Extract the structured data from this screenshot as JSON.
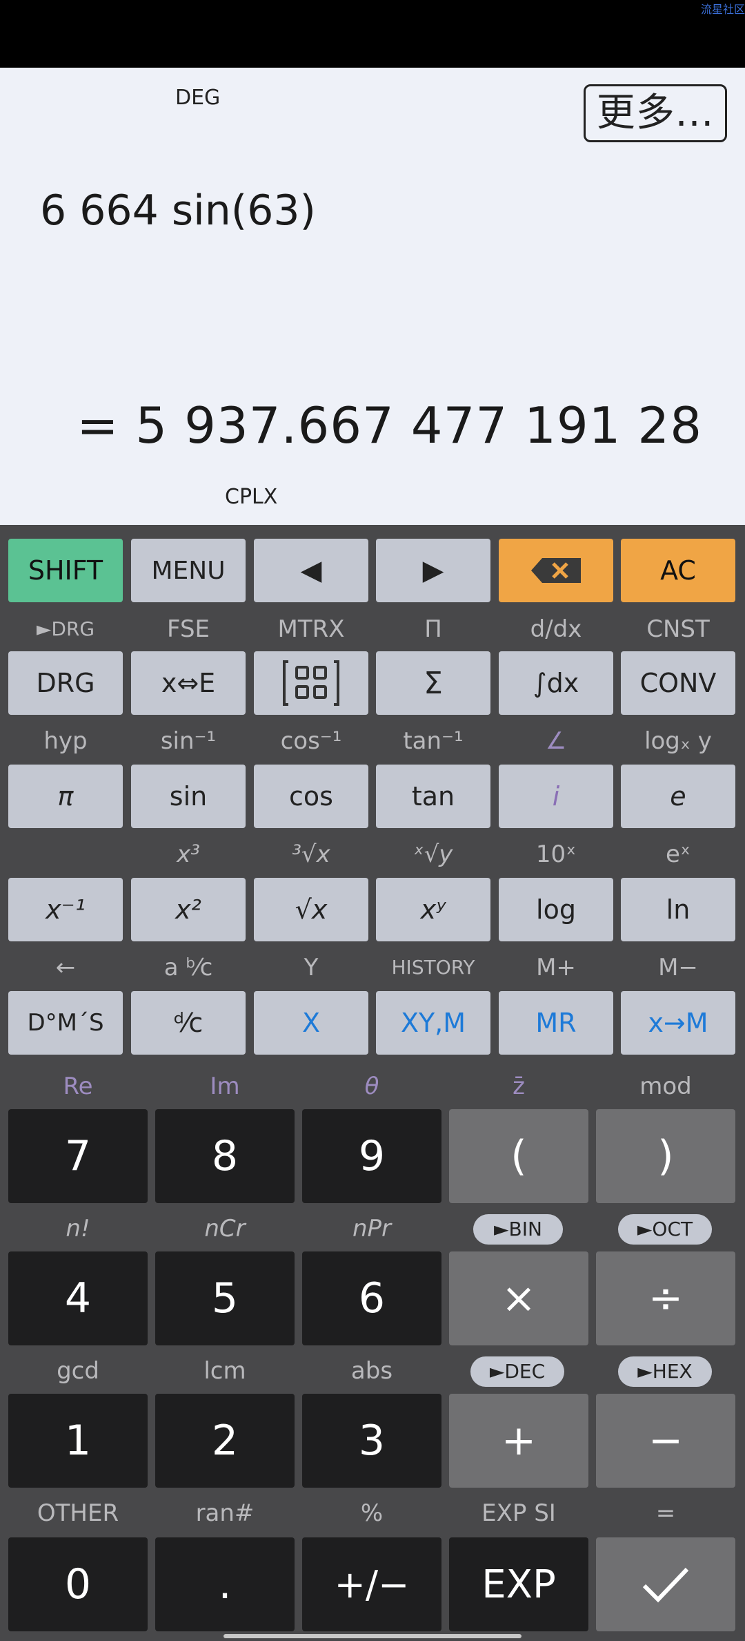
{
  "watermark": "流星社区",
  "display": {
    "angle_mode": "DEG",
    "more_button": "更多...",
    "expression": "6 664 sin(63)",
    "result": "= 5 937.667 477 191 28",
    "mode": "CPLX"
  },
  "keys": {
    "shift": "SHIFT",
    "menu": "MENU",
    "left": "◀",
    "right": "▶",
    "backspace": "⌫",
    "ac": "AC",
    "drg": "DRG",
    "xe": "x⇔E",
    "matrix": "[⠿]",
    "sigma": "Σ",
    "integral": "∫dx",
    "conv": "CONV",
    "pi": "π",
    "sin": "sin",
    "cos": "cos",
    "tan": "tan",
    "i": "i",
    "e": "e",
    "xinv": "x⁻¹",
    "xsq": "x²",
    "sqrt": "√x",
    "xpow": "xʸ",
    "log": "log",
    "ln": "ln",
    "dms": "D°M´S",
    "dc": "ᵈ⁄c",
    "x": "X",
    "xym": "XY,M",
    "mr": "MR",
    "xtom": "x→M",
    "n7": "7",
    "n8": "8",
    "n9": "9",
    "lparen": "(",
    "rparen": ")",
    "n4": "4",
    "n5": "5",
    "n6": "6",
    "mul": "×",
    "div": "÷",
    "n1": "1",
    "n2": "2",
    "n3": "3",
    "plus": "+",
    "minus": "−",
    "n0": "0",
    "dot": ".",
    "neg": "+/−",
    "exp": "EXP",
    "equals": "✓"
  },
  "labels": {
    "r1": [
      "►DRG",
      "FSE",
      "MTRX",
      "Π",
      "d/dx",
      "CNST"
    ],
    "r2": [
      "hyp",
      "sin⁻¹",
      "cos⁻¹",
      "tan⁻¹",
      "∠",
      "logₓ y"
    ],
    "r3": [
      "x³",
      "³√x",
      "ˣ√y",
      "10ˣ",
      "eˣ"
    ],
    "r4": [
      "←",
      "a ᵇ⁄c",
      "Y",
      "HISTORY",
      "M+",
      "M−"
    ],
    "r5": [
      "Re",
      "Im",
      "θ",
      "z̄",
      "mod"
    ],
    "r6": [
      "n!",
      "nCr",
      "nPr"
    ],
    "r6pills": [
      "►BIN",
      "►OCT"
    ],
    "r7": [
      "gcd",
      "lcm",
      "abs"
    ],
    "r7pills": [
      "►DEC",
      "►HEX"
    ],
    "r8": [
      "OTHER",
      "ran#",
      "%",
      "EXP SI",
      "="
    ]
  }
}
